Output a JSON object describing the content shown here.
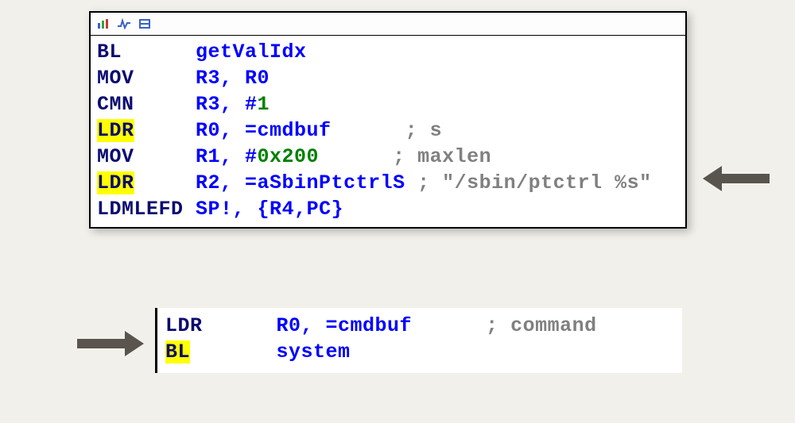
{
  "top_block": {
    "lines": [
      {
        "mnemonic": "BL",
        "hl": false,
        "ops": [
          {
            "t": "sym",
            "v": "getValIdx"
          }
        ],
        "comment": null
      },
      {
        "mnemonic": "MOV",
        "hl": false,
        "ops": [
          {
            "t": "op",
            "v": "R3, R0"
          }
        ],
        "comment": null
      },
      {
        "mnemonic": "CMN",
        "hl": false,
        "ops": [
          {
            "t": "op",
            "v": "R3, #"
          },
          {
            "t": "num",
            "v": "1"
          }
        ],
        "comment": null
      },
      {
        "mnemonic": "LDR",
        "hl": true,
        "ops": [
          {
            "t": "op",
            "v": "R0, ="
          },
          {
            "t": "sym",
            "v": "cmdbuf"
          }
        ],
        "pad": 6,
        "comment": "; s"
      },
      {
        "mnemonic": "MOV",
        "hl": false,
        "ops": [
          {
            "t": "op",
            "v": "R1, #"
          },
          {
            "t": "num",
            "v": "0x200"
          }
        ],
        "pad": 6,
        "comment": "; maxlen"
      },
      {
        "mnemonic": "LDR",
        "hl": true,
        "ops": [
          {
            "t": "op",
            "v": "R2, ="
          },
          {
            "t": "sym",
            "v": "aSbinPtctrlS"
          }
        ],
        "pad": 1,
        "comment": "; \"/sbin/ptctrl %s\""
      },
      {
        "mnemonic": "LDMLEFD",
        "hl": false,
        "ops": [
          {
            "t": "op",
            "v": "SP!, {R4,PC}"
          }
        ],
        "comment": null
      }
    ]
  },
  "bottom_block": {
    "lines": [
      {
        "mnemonic": "LDR",
        "hl": false,
        "ops": [
          {
            "t": "op",
            "v": "R0, ="
          },
          {
            "t": "sym",
            "v": "cmdbuf"
          }
        ],
        "pad": 6,
        "comment": "; command"
      },
      {
        "mnemonic": "BL",
        "hl": true,
        "ops": [
          {
            "t": "sym",
            "v": "system"
          }
        ],
        "comment": null
      }
    ]
  },
  "toolbar_icons": [
    "bar-chart-icon",
    "pulse-icon",
    "block-icon"
  ],
  "mnemonic_col_width": 8,
  "bottom_mnemonic_col_width": 9
}
